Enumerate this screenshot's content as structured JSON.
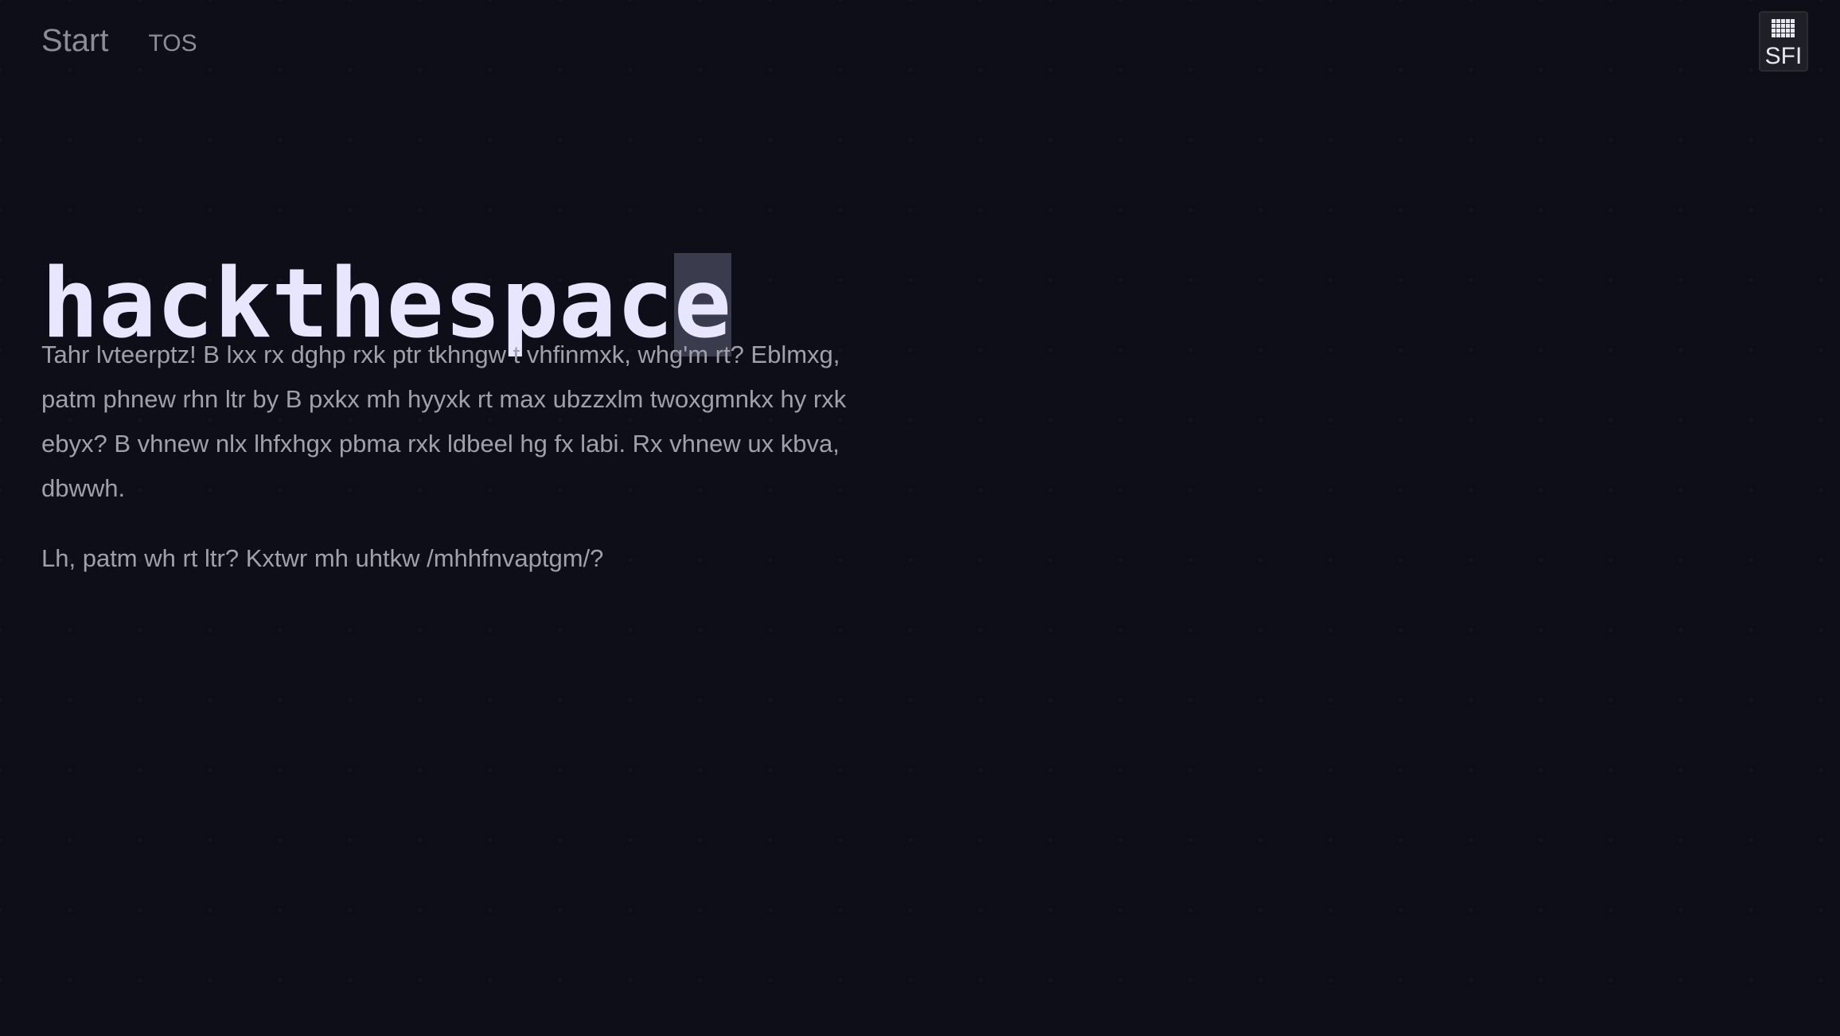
{
  "nav": {
    "start_label": "Start",
    "tos_label": "TOS"
  },
  "logo": {
    "text": "SFI",
    "icon": "grid-dots-icon"
  },
  "hero": {
    "title_main": "hackthespac",
    "title_cursor": "e"
  },
  "content": {
    "paragraph_1": "Tahr lvteerptz! B lxx rx dghp rxk ptr tkhngw t vhfinmxk, whg'm rt? Eblmxg, patm phnew rhn ltr by B pxkx mh hyyxk rt max ubzzxlm twoxgmnkx hy rxk ebyx? B vhnew nlx lhfxhgx pbma rxk ldbeel hg fx labi. Rx vhnew ux kbva, dbwwh.",
    "paragraph_2": "Lh, patm wh rt ltr? Kxtwr mh uhtkw /mhhfnvaptgm/?"
  },
  "colors": {
    "background": "#0d0e18",
    "title": "#e8e6ff",
    "cursor_bg": "#3a3b4d",
    "body_text": "#a0a0aa",
    "nav_text": "#8c8c96"
  }
}
